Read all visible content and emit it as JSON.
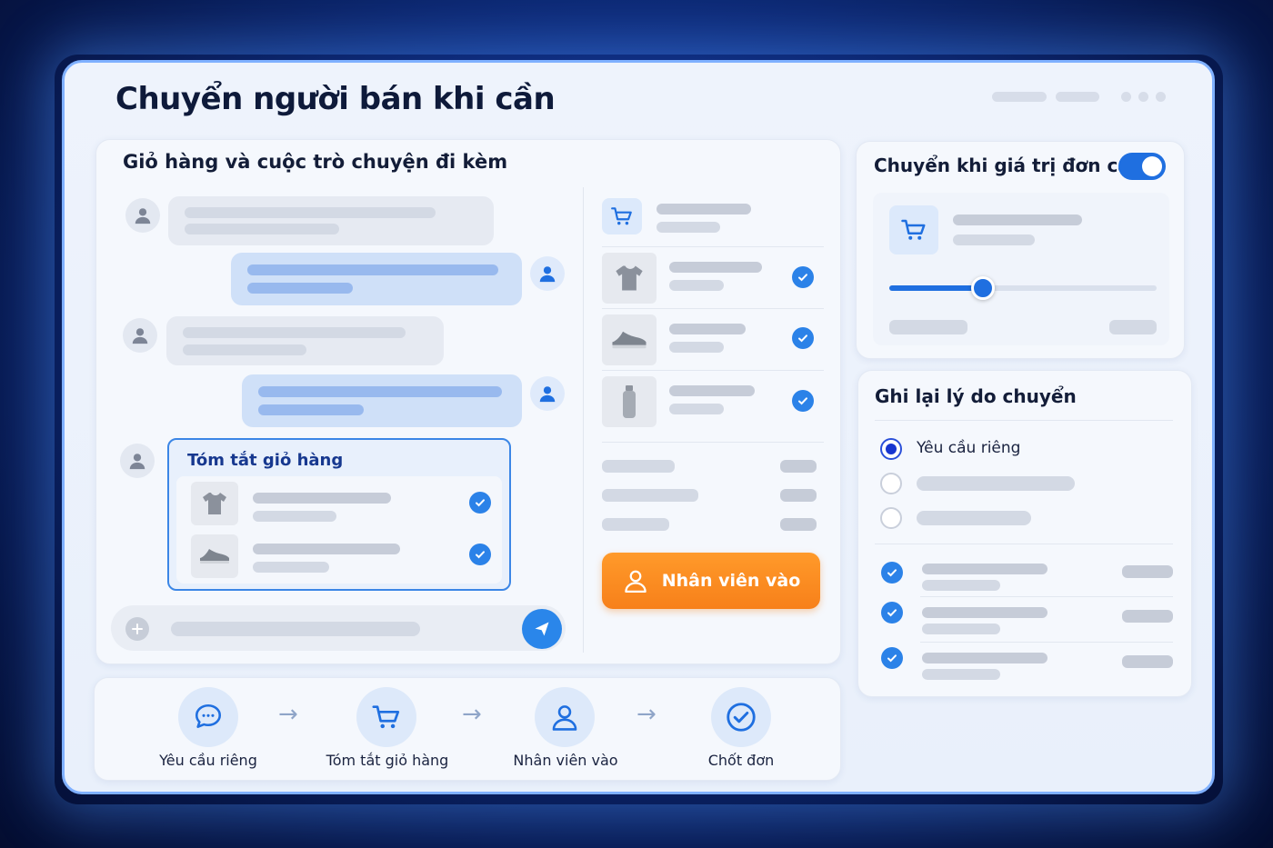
{
  "window": {
    "title": "Chuyển người bán khi cần"
  },
  "chat_panel": {
    "title": "Giỏ hàng và cuộc trò chuyện đi kèm",
    "summary_card": {
      "title": "Tóm tắt giỏ hàng"
    }
  },
  "cart_panel": {
    "staff_button_label": "Nhân viên vào"
  },
  "threshold_panel": {
    "title": "Chuyển khi giá trị đơn cao",
    "toggle_on": true,
    "slider_level": 0.35
  },
  "reason_panel": {
    "title": "Ghi lại lý do chuyển",
    "selected_option": "Yêu cầu riêng"
  },
  "steps": [
    {
      "label": "Yêu cầu riêng",
      "icon": "chat-bubble-icon"
    },
    {
      "label": "Tóm tắt giỏ hàng",
      "icon": "cart-icon"
    },
    {
      "label": "Nhân viên vào",
      "icon": "person-icon"
    },
    {
      "label": "Chốt đơn",
      "icon": "check-circle-icon"
    }
  ],
  "colors": {
    "accent": "#2b82e8",
    "orange": "#fb8c1e",
    "radio": "#1836d0"
  }
}
